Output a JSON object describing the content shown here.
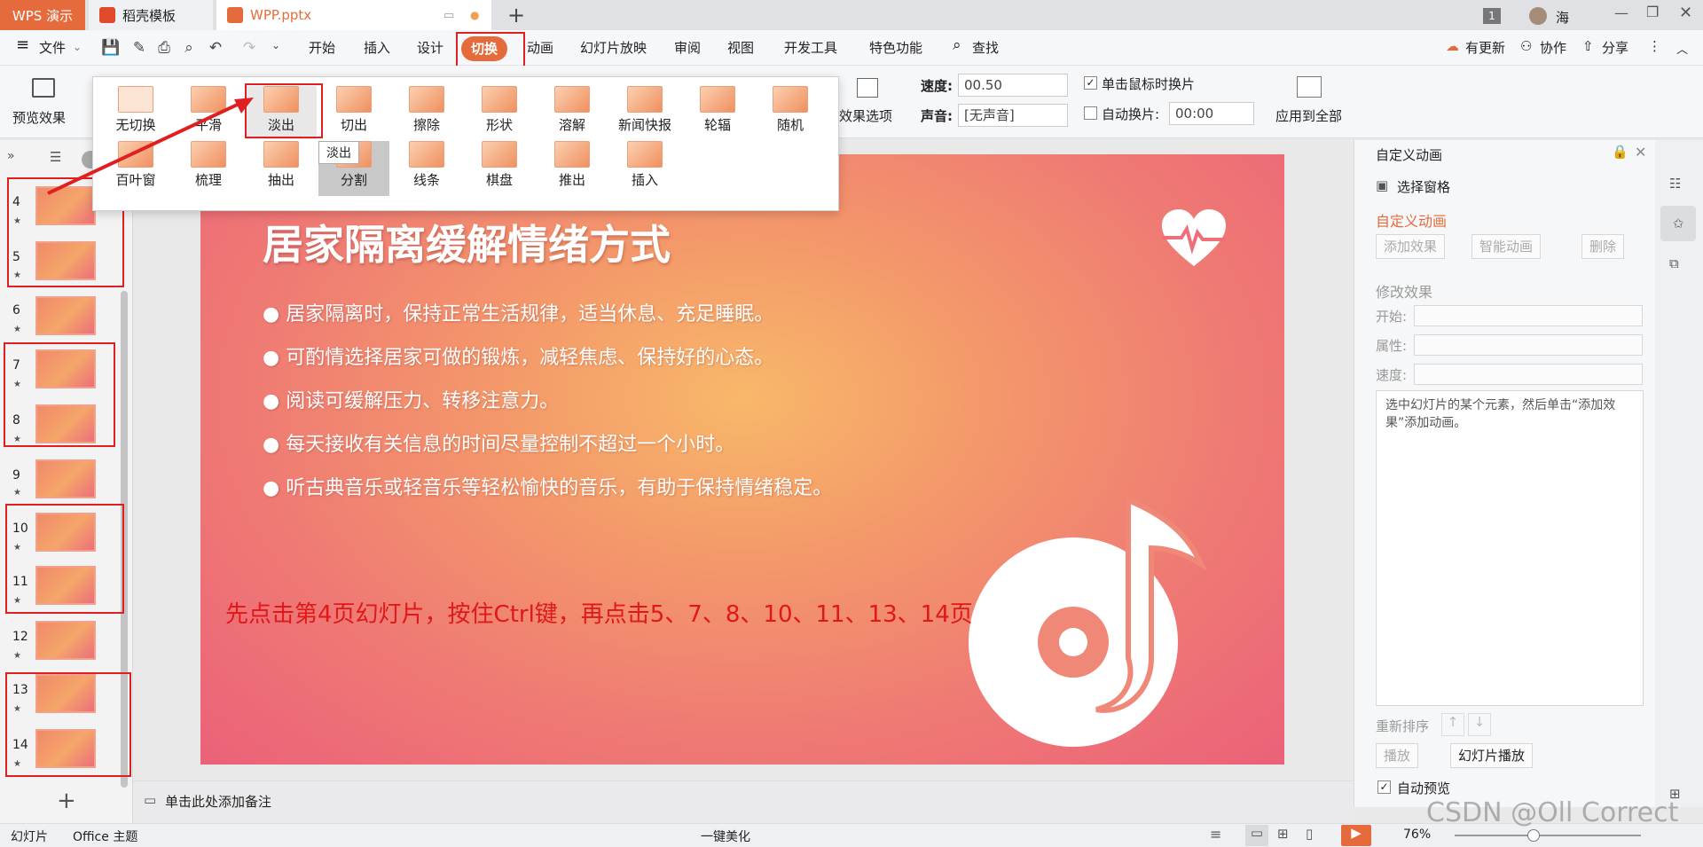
{
  "tabs": {
    "app": "WPS 演示",
    "template": "稻壳模板",
    "document": "WPP.pptx",
    "window_count": "1",
    "user": "海"
  },
  "menu": {
    "file": "文件",
    "items": [
      "开始",
      "插入",
      "设计",
      "切换",
      "动画",
      "幻灯片放映",
      "审阅",
      "视图",
      "开发工具",
      "特色功能"
    ],
    "search": "查找",
    "update": "有更新",
    "collab": "协作",
    "share": "分享"
  },
  "ribbon": {
    "preview": "预览效果",
    "effect_options": "效果选项",
    "speed_label": "速度:",
    "speed_value": "00.50",
    "sound_label": "声音:",
    "sound_value": "[无声音]",
    "click_switch": "单击鼠标时换片",
    "auto_switch": "自动换片:",
    "auto_time": "00:00",
    "apply_all": "应用到全部"
  },
  "effects": {
    "row1": [
      "无切换",
      "平滑",
      "淡出",
      "切出",
      "擦除",
      "形状",
      "溶解",
      "新闻快报",
      "轮辐",
      "随机"
    ],
    "row2": [
      "百叶窗",
      "梳理",
      "抽出",
      "分割",
      "线条",
      "棋盘",
      "推出",
      "插入"
    ],
    "tooltip": "淡出"
  },
  "slides": {
    "numbers": [
      "4",
      "5",
      "6",
      "7",
      "8",
      "9",
      "10",
      "11",
      "12",
      "13",
      "14"
    ],
    "add": "+"
  },
  "slide": {
    "title": "居家隔离缓解情绪方式",
    "bullets": [
      "居家隔离时，保持正常生活规律，适当休息、充足睡眠。",
      "可酌情选择居家可做的锻炼，减轻焦虑、保持好的心态。",
      "阅读可缓解压力、转移注意力。",
      "每天接收有关信息的时间尽量控制不超过一个小时。",
      "听古典音乐或轻音乐等轻松愉快的音乐，有助于保持情绪稳定。"
    ],
    "instruction": "先点击第4页幻灯片，按住Ctrl键，再点击5、7、8、10、11、13、14页"
  },
  "right_panel": {
    "title": "自定义动画",
    "select_pane": "选择窗格",
    "section": "自定义动画",
    "add_effect": "添加效果",
    "smart_anim": "智能动画",
    "delete": "删除",
    "modify": "修改效果",
    "start": "开始:",
    "property": "属性:",
    "speed": "速度:",
    "hint": "选中幻灯片的某个元素，然后单击“添加效果”添加动画。",
    "reorder": "重新排序",
    "play": "播放",
    "slideshow": "幻灯片播放",
    "auto_preview": "自动预览"
  },
  "notes": "单击此处添加备注",
  "status": {
    "slide_label": "幻灯片",
    "theme": "Office 主题",
    "beautify": "一键美化",
    "zoom": "76%",
    "watermark": "CSDN @Oll Correct"
  },
  "colors": {
    "accent": "#e66b3c",
    "annotation": "#e02020"
  }
}
